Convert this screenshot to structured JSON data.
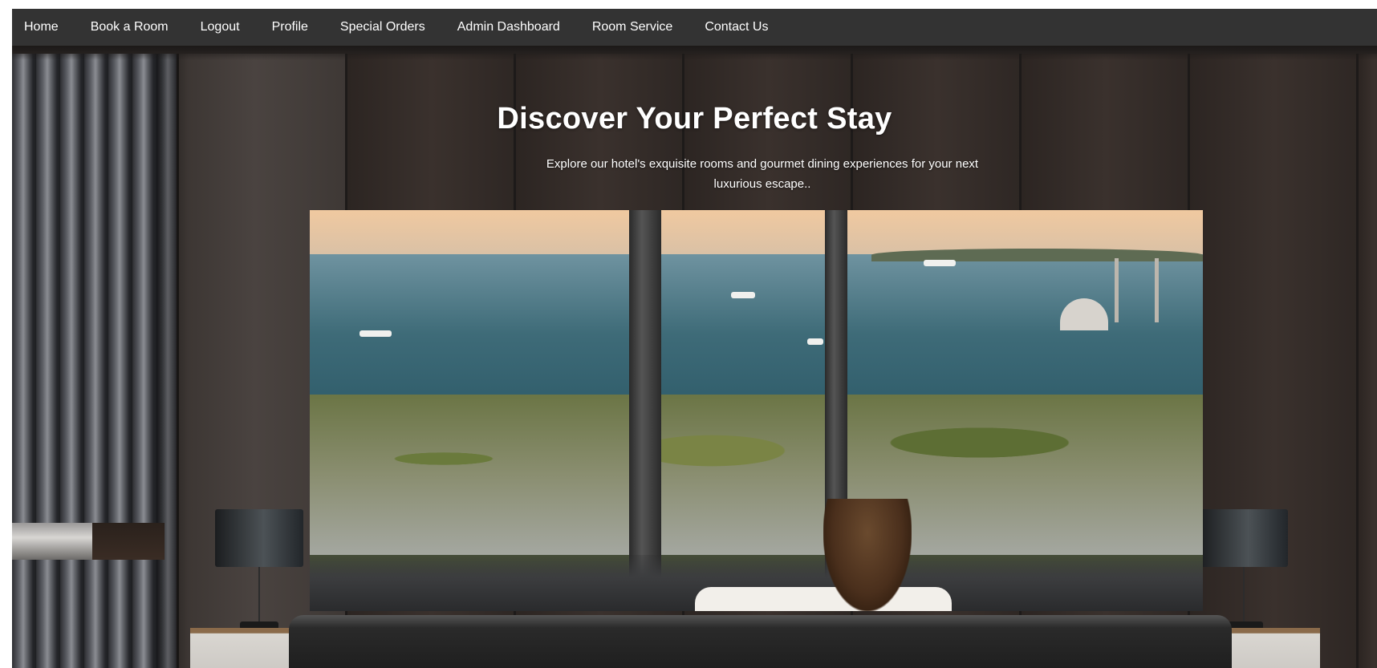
{
  "nav": {
    "items": [
      {
        "label": "Home"
      },
      {
        "label": "Book a Room"
      },
      {
        "label": "Logout"
      },
      {
        "label": "Profile"
      },
      {
        "label": "Special Orders"
      },
      {
        "label": "Admin Dashboard"
      },
      {
        "label": "Room Service"
      },
      {
        "label": "Contact Us"
      }
    ]
  },
  "hero": {
    "title": "Discover Your Perfect Stay",
    "subtitle": "Explore our hotel's exquisite rooms and gourmet dining experiences for your next luxurious escape.."
  },
  "colors": {
    "navbar_bg": "#333333",
    "nav_text": "#ffffff",
    "hero_text": "#ffffff"
  }
}
